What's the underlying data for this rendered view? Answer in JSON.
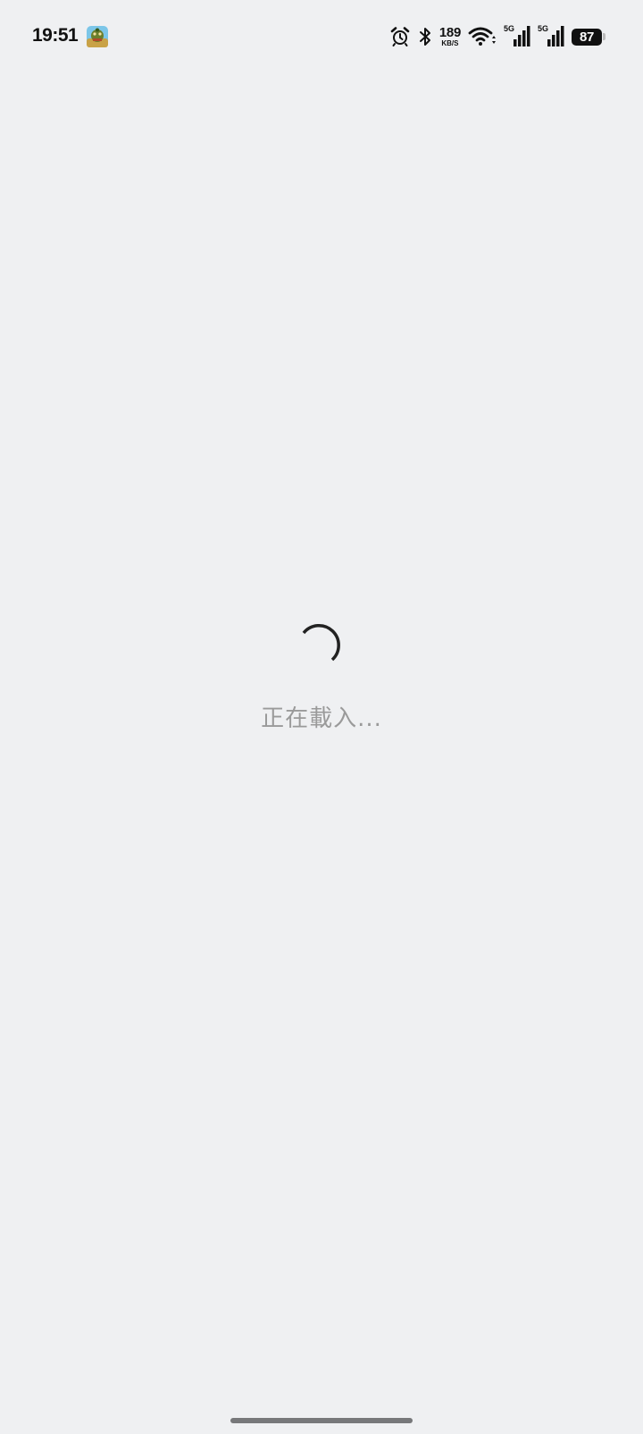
{
  "status_bar": {
    "time": "19:51",
    "app_notification_icon": "game-app-icon",
    "icons": [
      "alarm-icon",
      "bluetooth-icon",
      "wifi-icon",
      "signal-icon",
      "signal-icon"
    ],
    "net_speed_value": "189",
    "net_speed_unit": "KB/S",
    "sim1_label": "5G",
    "sim2_label": "5G",
    "battery_level": "87"
  },
  "loading": {
    "indicator_icon": "spinner-icon",
    "text": "正在載入..."
  },
  "colors": {
    "background": "#eff0f2",
    "text_muted": "#9a9a9a",
    "spinner": "#222222"
  }
}
